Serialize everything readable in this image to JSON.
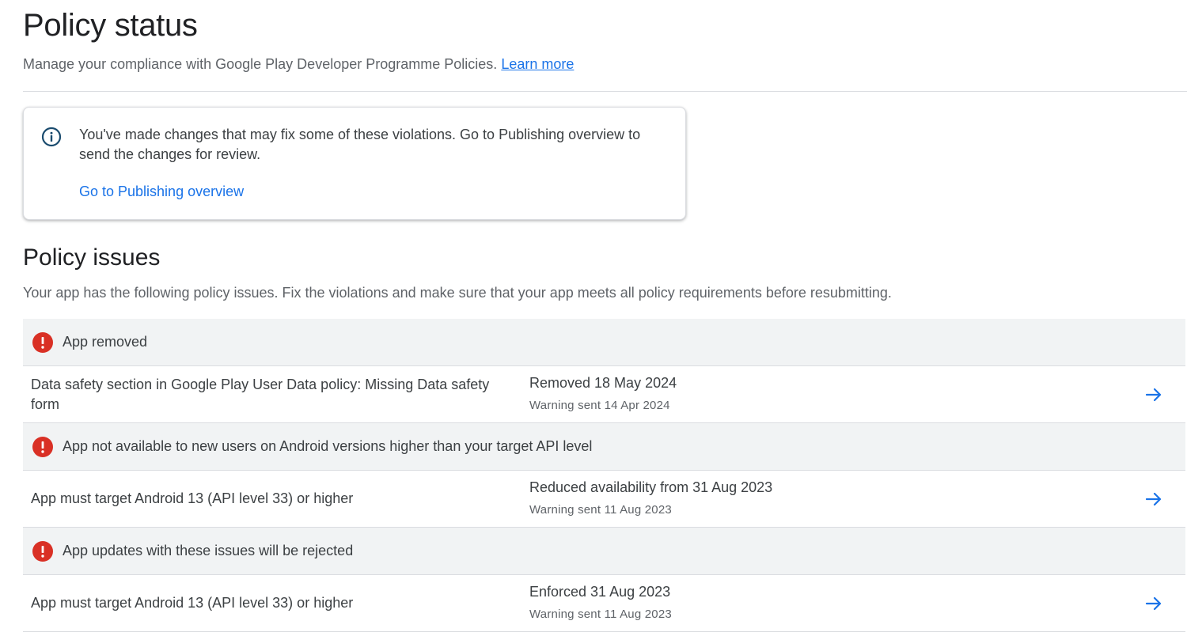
{
  "header": {
    "title": "Policy status",
    "subtitle": "Manage your compliance with Google Play Developer Programme Policies.",
    "learn_more": "Learn more"
  },
  "notice": {
    "icon": "info-icon",
    "text": "You've made changes that may fix some of these violations. Go to Publishing overview to send the changes for review.",
    "link": "Go to Publishing overview"
  },
  "issues_section": {
    "title": "Policy issues",
    "description": "Your app has the following policy issues. Fix the violations and make sure that your app meets all policy requirements before resubmitting."
  },
  "groups": [
    {
      "title": "App removed",
      "icon": "error-icon",
      "row": {
        "name": "Data safety section in Google Play User Data policy: Missing Data safety form",
        "status": "Removed 18 May 2024",
        "warning": "Warning sent 14 Apr 2024"
      }
    },
    {
      "title": "App not available to new users on Android versions higher than your target API level",
      "icon": "error-icon",
      "row": {
        "name": "App must target Android 13 (API level 33) or higher",
        "status": "Reduced availability from 31 Aug 2023",
        "warning": "Warning sent 11 Aug 2023"
      }
    },
    {
      "title": "App updates with these issues will be rejected",
      "icon": "error-icon",
      "row": {
        "name": "App must target Android 13 (API level 33) or higher",
        "status": "Enforced 31 Aug 2023",
        "warning": "Warning sent 11 Aug 2023"
      }
    }
  ],
  "colors": {
    "accent": "#1a73e8",
    "error": "#d93025",
    "info": "#1a4b6e",
    "header_bg": "#f1f3f4"
  }
}
